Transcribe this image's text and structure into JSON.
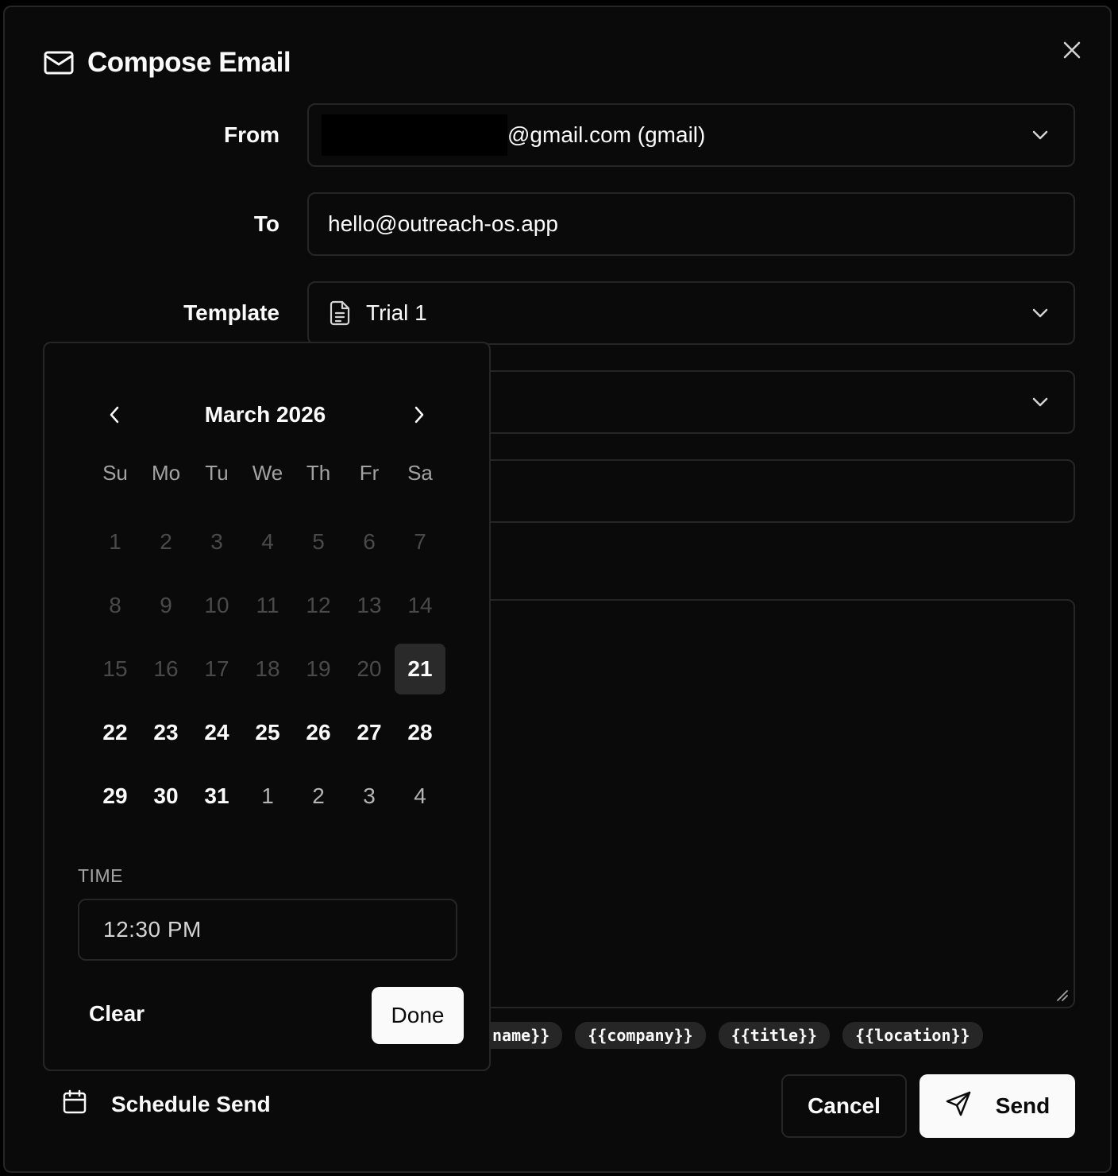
{
  "dialog": {
    "title": "Compose Email",
    "icon": "mail-icon"
  },
  "form": {
    "from_label": "From",
    "from_value": "@gmail.com (gmail)",
    "to_label": "To",
    "to_value": "hello@outreach-os.app",
    "template_label": "Template",
    "template_value": "Trial 1"
  },
  "variables": [
    "name}}",
    "{{company}}",
    "{{title}}",
    "{{location}}"
  ],
  "footer": {
    "schedule_label": "Schedule Send",
    "cancel_label": "Cancel",
    "send_label": "Send"
  },
  "date_picker": {
    "month_label": "March 2026",
    "weekdays": [
      "Su",
      "Mo",
      "Tu",
      "We",
      "Th",
      "Fr",
      "Sa"
    ],
    "weeks": [
      [
        "1",
        "2",
        "3",
        "4",
        "5",
        "6",
        "7"
      ],
      [
        "8",
        "9",
        "10",
        "11",
        "12",
        "13",
        "14"
      ],
      [
        "15",
        "16",
        "17",
        "18",
        "19",
        "20",
        "21"
      ],
      [
        "22",
        "23",
        "24",
        "25",
        "26",
        "27",
        "28"
      ],
      [
        "29",
        "30",
        "31",
        "1",
        "2",
        "3",
        "4"
      ]
    ],
    "selected_day": "21",
    "time_label": "TIME",
    "time_value": "12:30 PM",
    "clear_label": "Clear",
    "done_label": "Done"
  },
  "colors": {
    "background": "#0a0a0a",
    "border": "#262626",
    "primary": "#fafafa",
    "muted": "#a3a3a3",
    "disabled": "#4a4a4a"
  }
}
